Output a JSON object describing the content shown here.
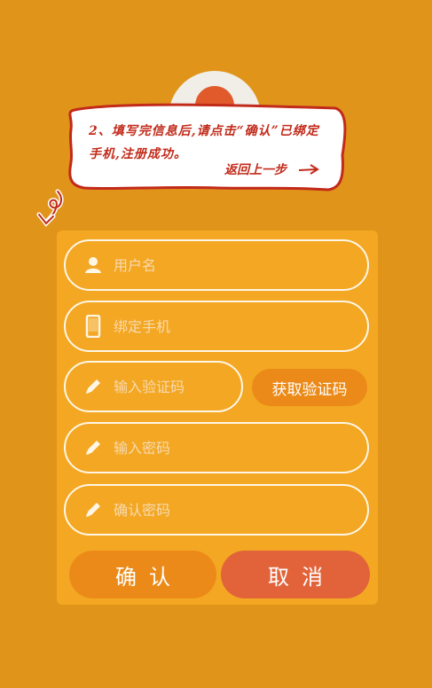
{
  "tooltip": {
    "message": "2、填写完信息后,请点击“确认”已绑定手机,注册成功。",
    "back_link": "返回上一步"
  },
  "form": {
    "username": {
      "placeholder": "用户名",
      "icon": "user-icon"
    },
    "phone": {
      "placeholder": "绑定手机",
      "icon": "phone-icon"
    },
    "code": {
      "placeholder": "输入验证码",
      "icon": "pencil-icon"
    },
    "get_code_label": "获取验证码",
    "password": {
      "placeholder": "输入密码",
      "icon": "pencil-icon"
    },
    "confirm_password": {
      "placeholder": "确认密码",
      "icon": "pencil-icon"
    }
  },
  "actions": {
    "confirm_label": "确认",
    "cancel_label": "取消"
  },
  "colors": {
    "background": "#E0951A",
    "card": "#F3A722",
    "confirm": "#EB8A18",
    "cancel": "#E2633A",
    "tooltip_text": "#C22A1A"
  }
}
